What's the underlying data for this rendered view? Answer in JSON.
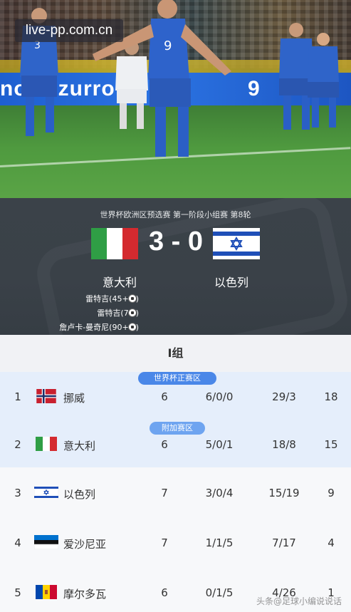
{
  "watermark": "live-pp.com.cn",
  "photo": {
    "ad_left": "no azzurro",
    "ad_right": "9"
  },
  "match": {
    "competition": "世界杯欧洲区预选赛 第一阶段小组赛 第8轮",
    "score": "3 - 0",
    "home": {
      "name": "意大利",
      "flag": "italy-flag-icon"
    },
    "away": {
      "name": "以色列",
      "flag": "israel-flag-icon"
    },
    "scorers": [
      {
        "text": "雷特吉(45+2')"
      },
      {
        "text": "雷特吉(74')"
      },
      {
        "text": "詹卢卡-曼奇尼(90+3')"
      }
    ]
  },
  "standings": {
    "group_title": "I组",
    "zones": {
      "direct": "世界杯正赛区",
      "playoff": "附加赛区"
    },
    "rows": [
      {
        "rank": "1",
        "team": "挪威",
        "played": "6",
        "wdl": "6/0/0",
        "goals": "29/3",
        "points": "18",
        "flag": "norway-flag-icon"
      },
      {
        "rank": "2",
        "team": "意大利",
        "played": "6",
        "wdl": "5/0/1",
        "goals": "18/8",
        "points": "15",
        "flag": "italy-flag-icon"
      },
      {
        "rank": "3",
        "team": "以色列",
        "played": "7",
        "wdl": "3/0/4",
        "goals": "15/19",
        "points": "9",
        "flag": "israel-flag-icon"
      },
      {
        "rank": "4",
        "team": "爱沙尼亚",
        "played": "7",
        "wdl": "1/1/5",
        "goals": "7/17",
        "points": "4",
        "flag": "estonia-flag-icon"
      },
      {
        "rank": "5",
        "team": "摩尔多瓦",
        "played": "6",
        "wdl": "0/1/5",
        "goals": "4/26",
        "points": "1",
        "flag": "moldova-flag-icon"
      }
    ]
  },
  "footer_watermark": "头条@足球小编说说话"
}
